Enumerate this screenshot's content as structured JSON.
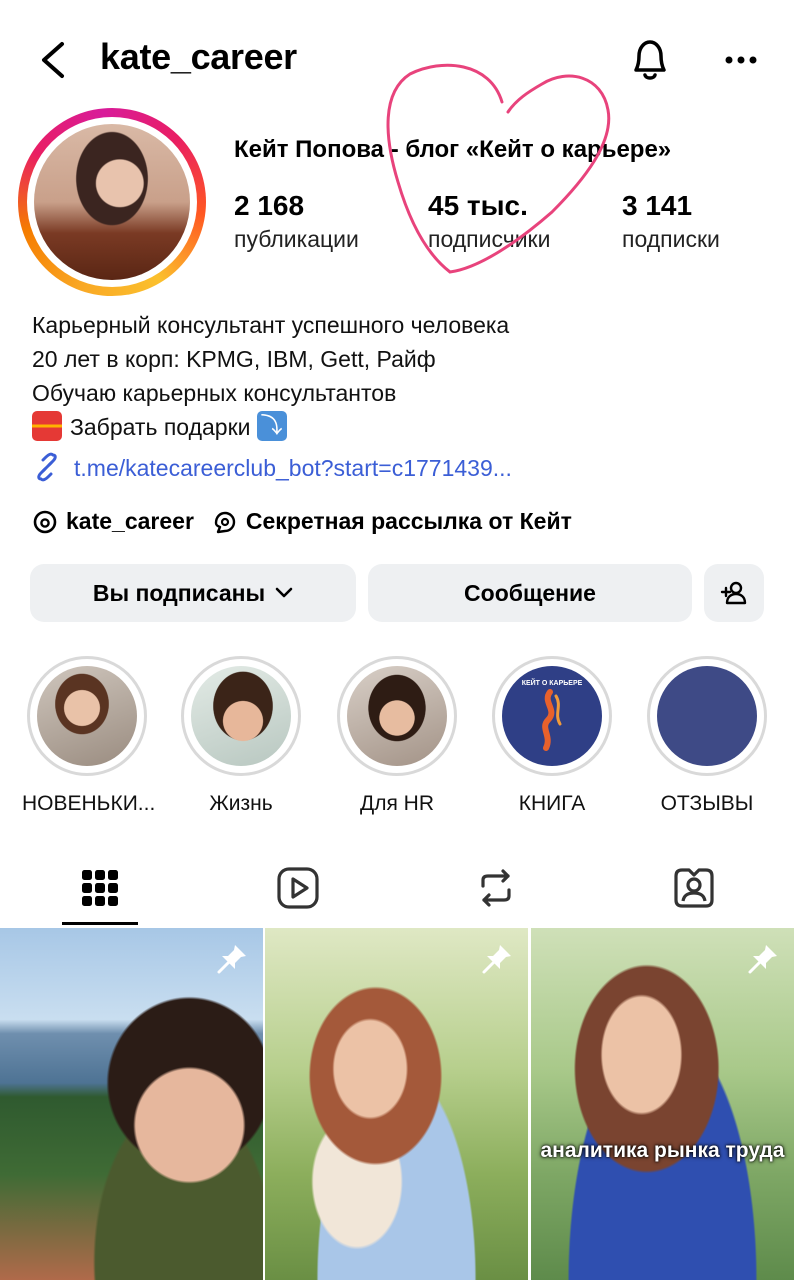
{
  "header": {
    "username": "kate_career"
  },
  "profile": {
    "full_name": "Кейт Попова - блог «Кейт о карьере»",
    "stats": [
      {
        "value": "2 168",
        "label": "публикации"
      },
      {
        "value": "45 тыс.",
        "label": "подписчики"
      },
      {
        "value": "3 141",
        "label": "подписки"
      }
    ],
    "bio": [
      "Карьерный консультант успешного человека",
      "20 лет в корп: KPMG, IBM, Gett, Райф",
      "Обучаю карьерных консультантов",
      "Забрать подарки"
    ],
    "link": "t.me/katecareerclub_bot?start=c1771439...",
    "threads_handle": "kate_career",
    "channel_label": "Секретная рассылка от Кейт"
  },
  "actions": {
    "following_label": "Вы подписаны",
    "message_label": "Сообщение"
  },
  "highlights": [
    {
      "label": "НОВЕНЬКИ..."
    },
    {
      "label": "Жизнь"
    },
    {
      "label": "Для HR"
    },
    {
      "label": "КНИГА",
      "cover_text": "КЕЙТ О КАРЬЕРЕ"
    },
    {
      "label": "ОТЗЫВЫ"
    }
  ],
  "tabs": [
    "grid-icon",
    "reels-icon",
    "reposts-icon",
    "tagged-icon"
  ],
  "posts": [
    {
      "pinned": true,
      "caption": ""
    },
    {
      "pinned": true,
      "caption": ""
    },
    {
      "pinned": true,
      "caption": "аналитика рынка труда"
    }
  ],
  "colors": {
    "link": "#3b5ed6",
    "heart": "#e8437c",
    "button_bg": "#eef0f2",
    "highlight_navy": "#3e4a86"
  }
}
